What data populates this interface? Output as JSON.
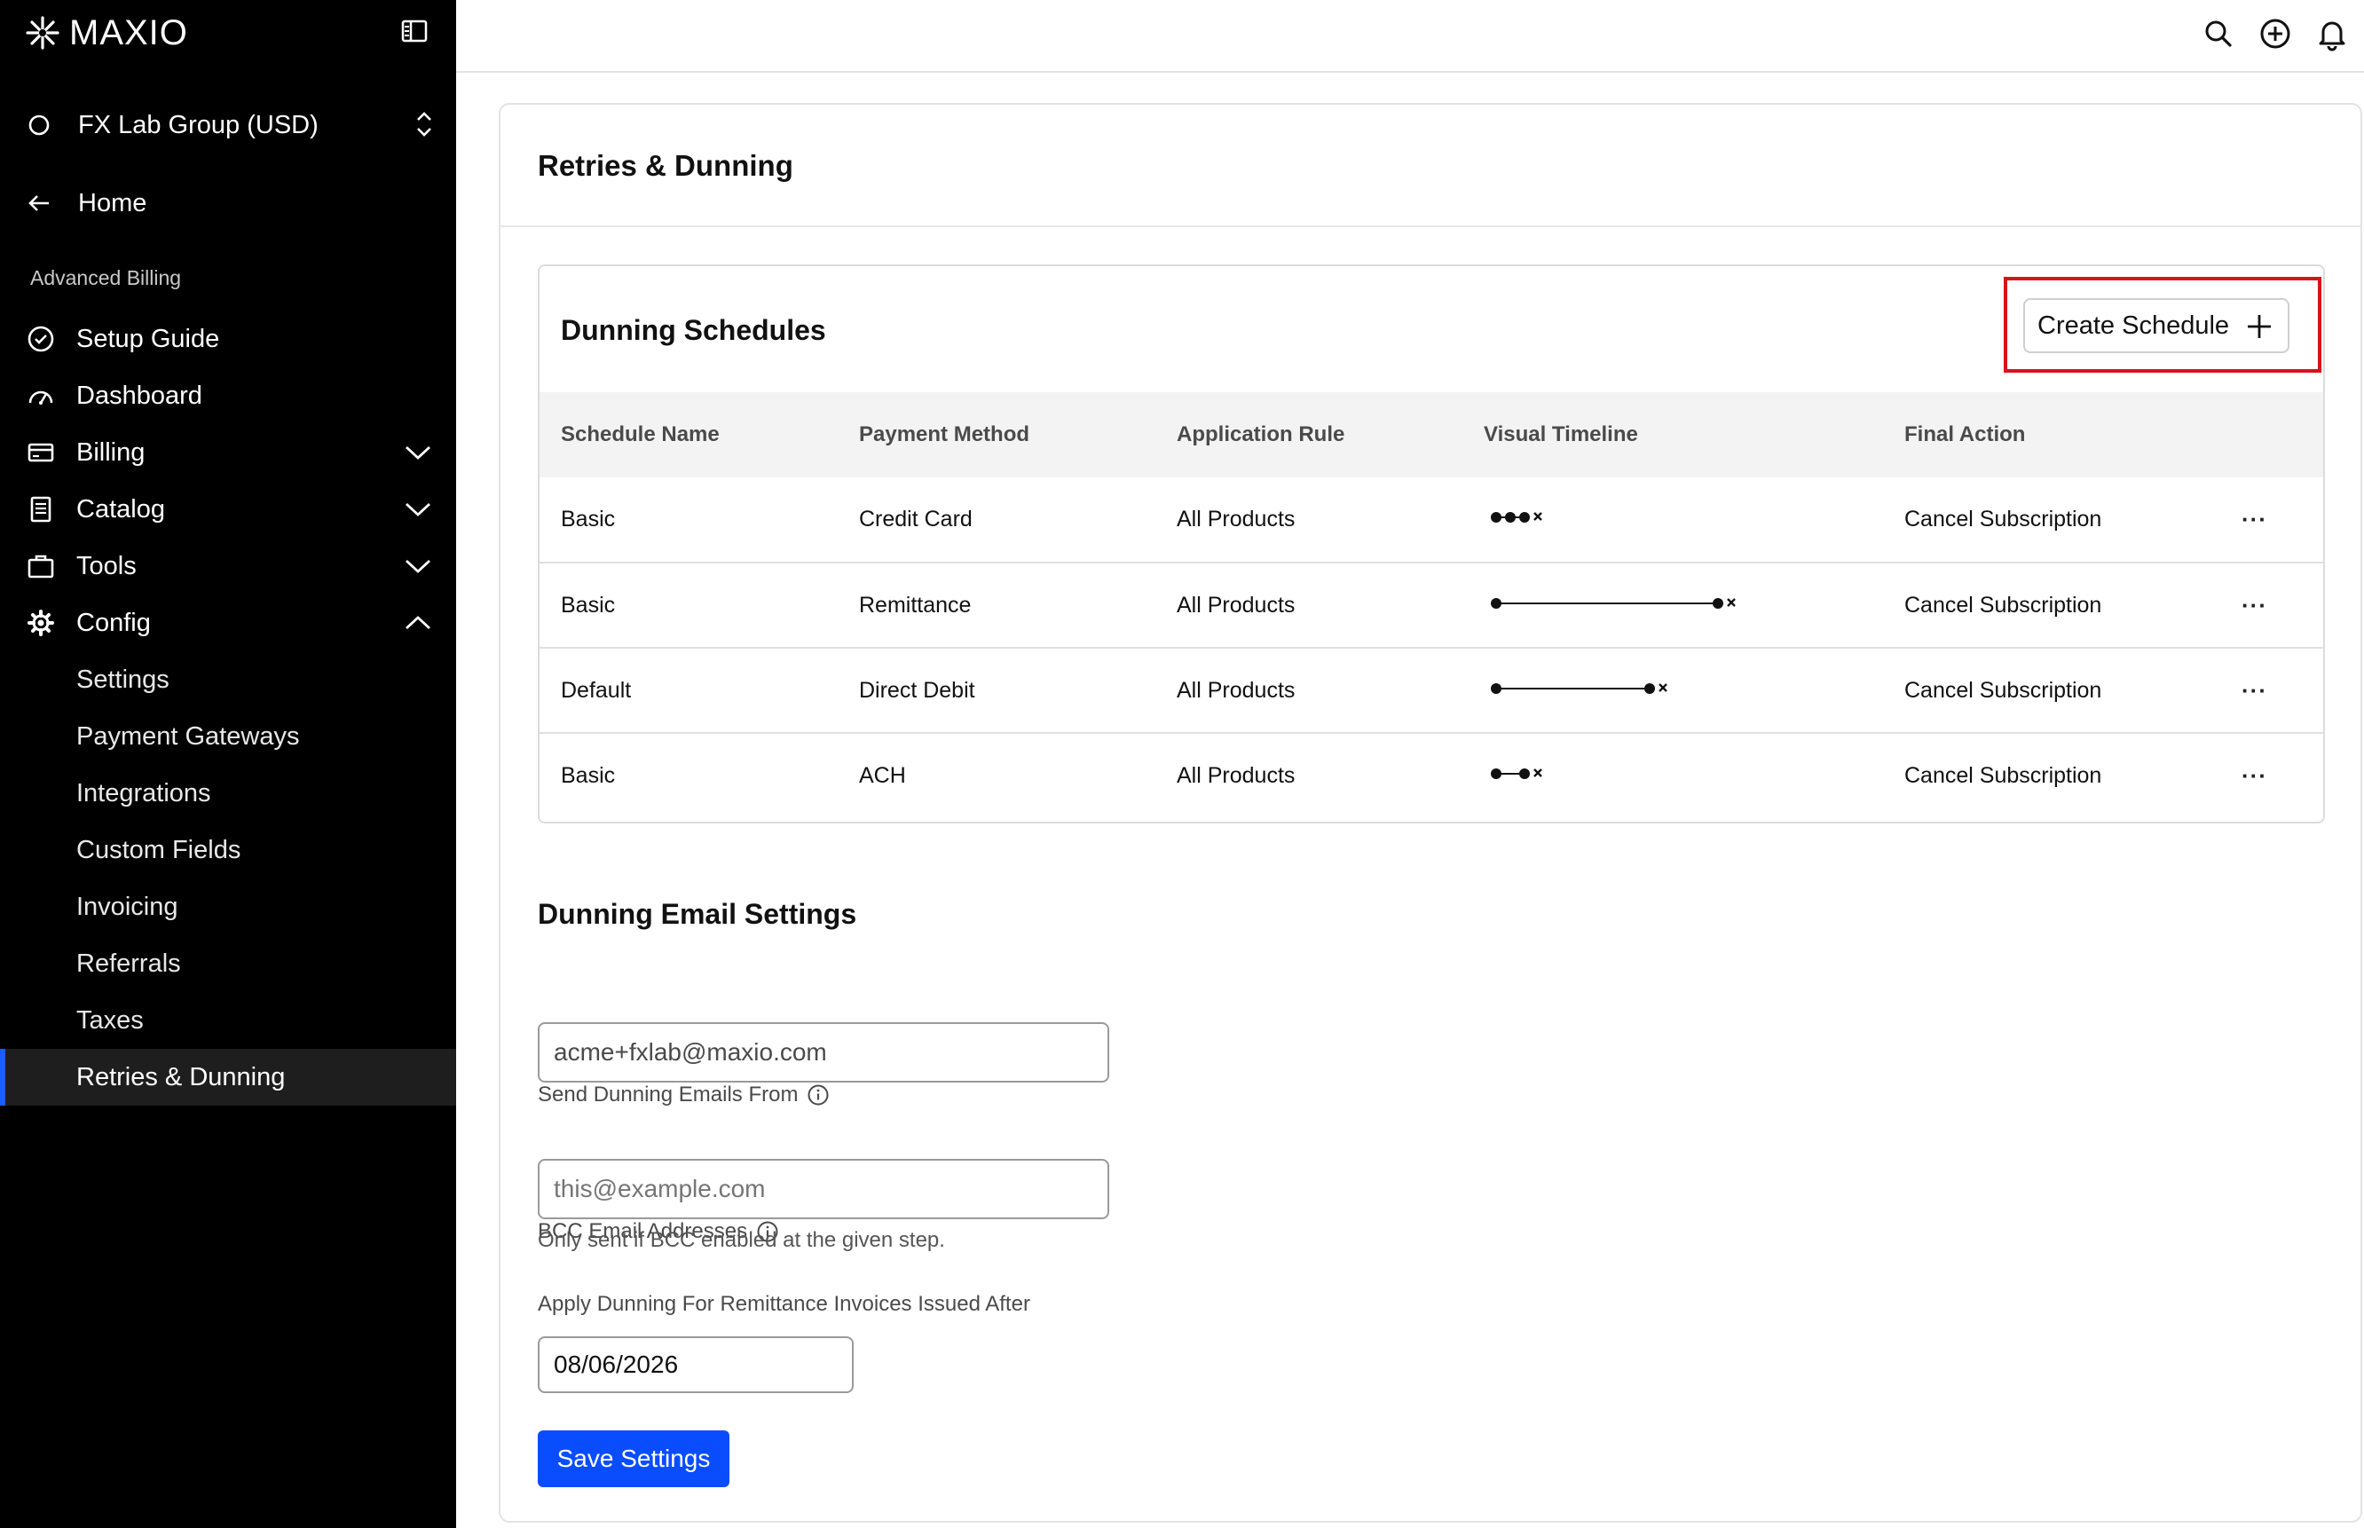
{
  "app": {
    "brand": "MAXIO",
    "accent": "#1a5eff",
    "highlight": "#d9121c"
  },
  "sidebar": {
    "workspace": "FX Lab Group (USD)",
    "home": "Home",
    "section": "Advanced Billing",
    "items": [
      {
        "label": "Setup Guide",
        "icon": "check-circle-icon"
      },
      {
        "label": "Dashboard",
        "icon": "gauge-icon"
      },
      {
        "label": "Billing",
        "icon": "card-icon",
        "expanded": false
      },
      {
        "label": "Catalog",
        "icon": "document-icon",
        "expanded": false
      },
      {
        "label": "Tools",
        "icon": "briefcase-icon",
        "expanded": false
      },
      {
        "label": "Config",
        "icon": "gear-icon",
        "expanded": true
      }
    ],
    "sub_items": [
      {
        "label": "Settings"
      },
      {
        "label": "Payment Gateways"
      },
      {
        "label": "Integrations"
      },
      {
        "label": "Custom Fields"
      },
      {
        "label": "Invoicing"
      },
      {
        "label": "Referrals"
      },
      {
        "label": "Taxes"
      },
      {
        "label": "Retries & Dunning",
        "active": true
      }
    ]
  },
  "topbar": {
    "icons": [
      "search-icon",
      "add-circle-icon",
      "bell-icon"
    ]
  },
  "page": {
    "title": "Retries & Dunning",
    "schedules": {
      "title": "Dunning Schedules",
      "create_label": "Create Schedule",
      "columns": [
        "Schedule Name",
        "Payment Method",
        "Application Rule",
        "Visual Timeline",
        "Final Action"
      ],
      "rows": [
        {
          "name": "Basic",
          "method": "Credit Card",
          "rule": "All Products",
          "final": "Cancel Subscription"
        },
        {
          "name": "Basic",
          "method": "Remittance",
          "rule": "All Products",
          "final": "Cancel Subscription"
        },
        {
          "name": "Default",
          "method": "Direct Debit",
          "rule": "All Products",
          "final": "Cancel Subscription"
        },
        {
          "name": "Basic",
          "method": "ACH",
          "rule": "All Products",
          "final": "Cancel Subscription"
        }
      ],
      "more_label": "···"
    },
    "email": {
      "title": "Dunning Email Settings",
      "from_label": "Send Dunning Emails From",
      "from_value": "acme+fxlab@maxio.com",
      "bcc_label": "BCC Email Addresses",
      "bcc_placeholder": "this@example.com",
      "bcc_help": "Only sent if BCC enabled at the given step.",
      "date_label": "Apply Dunning For Remittance Invoices Issued After",
      "date_value": "08/06/2026",
      "save_label": "Save Settings"
    }
  }
}
